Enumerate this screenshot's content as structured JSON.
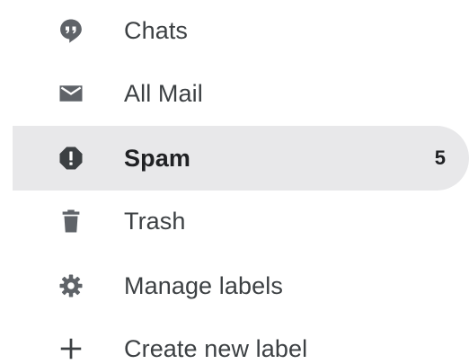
{
  "nav": {
    "items": [
      {
        "label": "Chats",
        "icon": "chat-icon"
      },
      {
        "label": "All Mail",
        "icon": "mail-icon"
      },
      {
        "label": "Spam",
        "icon": "spam-icon",
        "count": "5",
        "active": true
      },
      {
        "label": "Trash",
        "icon": "trash-icon"
      },
      {
        "label": "Manage labels",
        "icon": "gear-icon"
      },
      {
        "label": "Create new label",
        "icon": "plus-icon"
      }
    ]
  },
  "colors": {
    "icon": "#5f6368",
    "text": "#3c4043",
    "active_bg": "#e8e8ea"
  }
}
